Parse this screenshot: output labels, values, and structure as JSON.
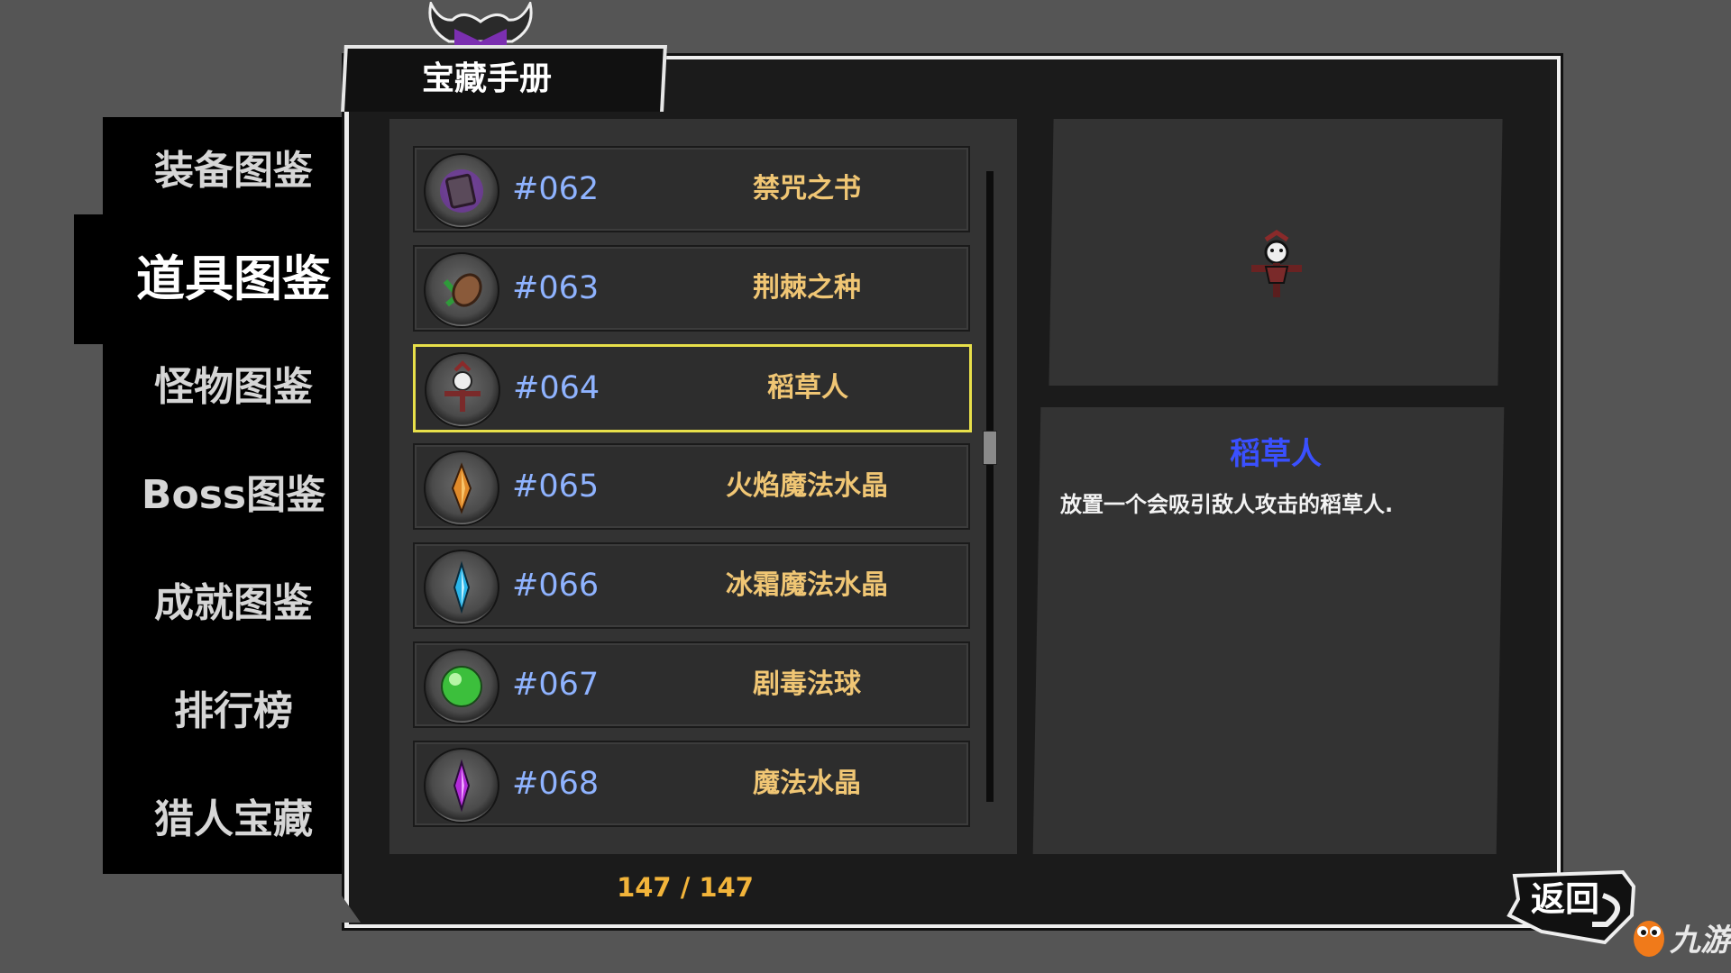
{
  "title": "宝藏手册",
  "sidebar": {
    "items": [
      {
        "label": "装备图鉴",
        "active": false
      },
      {
        "label": "道具图鉴",
        "active": true
      },
      {
        "label": "怪物图鉴",
        "active": false
      },
      {
        "label": "Boss图鉴",
        "active": false
      },
      {
        "label": "成就图鉴",
        "active": false
      },
      {
        "label": "排行榜",
        "active": false
      },
      {
        "label": "猎人宝藏",
        "active": false
      }
    ]
  },
  "list": {
    "rows": [
      {
        "number": "#062",
        "name": "禁咒之书",
        "icon": "book-icon",
        "selected": false
      },
      {
        "number": "#063",
        "name": "荆棘之种",
        "icon": "seed-icon",
        "selected": false
      },
      {
        "number": "#064",
        "name": "稻草人",
        "icon": "scarecrow-icon",
        "selected": true
      },
      {
        "number": "#065",
        "name": "火焰魔法水晶",
        "icon": "fire-crystal-icon",
        "selected": false
      },
      {
        "number": "#066",
        "name": "冰霜魔法水晶",
        "icon": "ice-crystal-icon",
        "selected": false
      },
      {
        "number": "#067",
        "name": "剧毒法球",
        "icon": "poison-orb-icon",
        "selected": false
      },
      {
        "number": "#068",
        "name": "魔法水晶",
        "icon": "magic-crystal-icon",
        "selected": false
      }
    ],
    "page_count": "147 / 147"
  },
  "detail": {
    "name": "稻草人",
    "description": "放置一个会吸引敌人攻击的稻草人."
  },
  "back_button": {
    "label": "返回"
  },
  "watermark": {
    "text": "九游"
  },
  "colors": {
    "highlight": "#e8e04a",
    "item_number": "#8fb3ff",
    "item_name": "#f0c674",
    "detail_title": "#3a50ff",
    "page_count": "#f2b43a"
  }
}
